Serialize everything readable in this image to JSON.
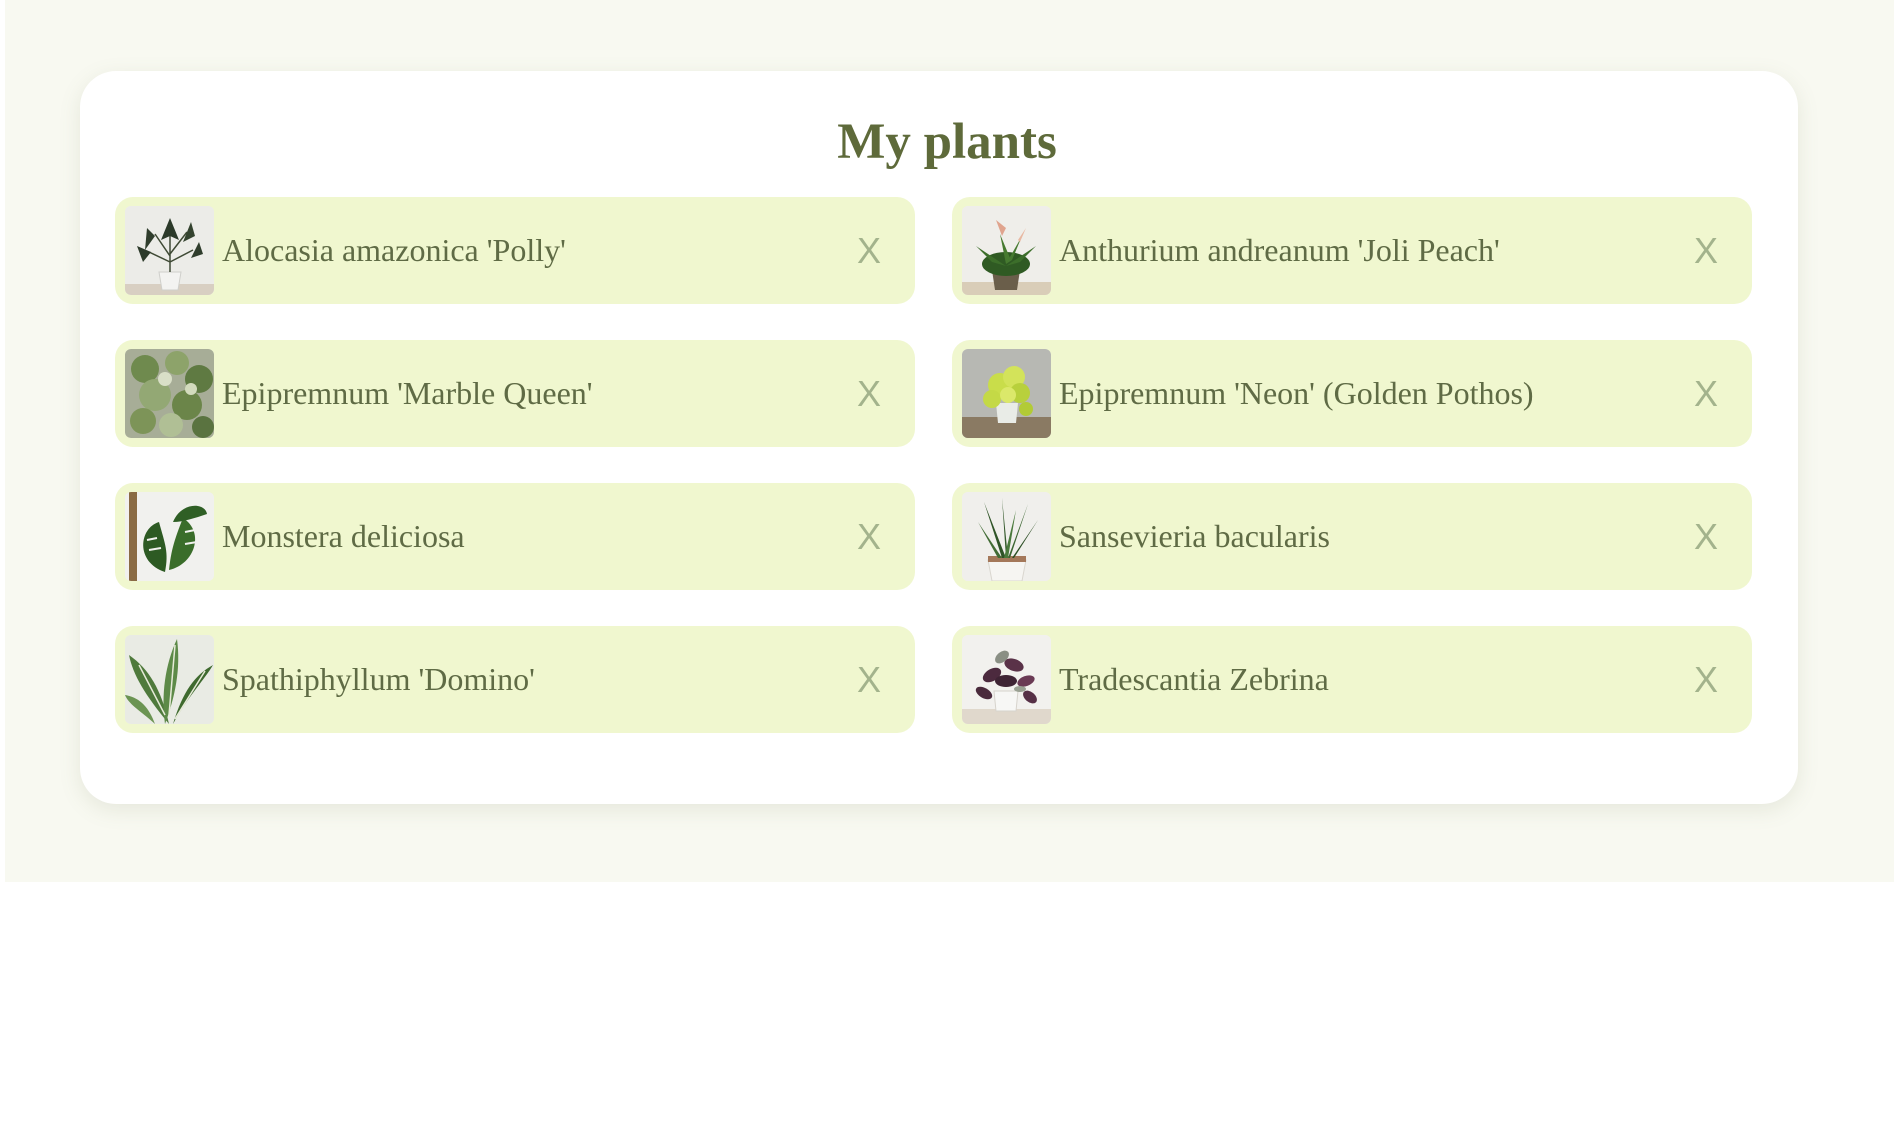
{
  "page": {
    "title": "My plants"
  },
  "colors": {
    "page_background": "#f8f9f1",
    "card_background": "#ffffff",
    "item_background": "#f0f7cf",
    "title_color": "#5e6a3a",
    "text_color": "#5f6b45",
    "remove_color": "#a3b38c"
  },
  "plants": [
    {
      "name": "Alocasia amazonica 'Polly'",
      "remove_label": "X",
      "icon": "alocasia-photo"
    },
    {
      "name": "Anthurium andreanum 'Joli Peach'",
      "remove_label": "X",
      "icon": "anthurium-photo"
    },
    {
      "name": "Epipremnum 'Marble Queen'",
      "remove_label": "X",
      "icon": "marble-queen-photo"
    },
    {
      "name": "Epipremnum 'Neon' (Golden Pothos)",
      "remove_label": "X",
      "icon": "neon-pothos-photo"
    },
    {
      "name": "Monstera deliciosa",
      "remove_label": "X",
      "icon": "monstera-photo"
    },
    {
      "name": "Sansevieria bacularis",
      "remove_label": "X",
      "icon": "sansevieria-photo"
    },
    {
      "name": "Spathiphyllum 'Domino'",
      "remove_label": "X",
      "icon": "spathiphyllum-photo"
    },
    {
      "name": "Tradescantia Zebrina",
      "remove_label": "X",
      "icon": "tradescantia-photo"
    }
  ]
}
